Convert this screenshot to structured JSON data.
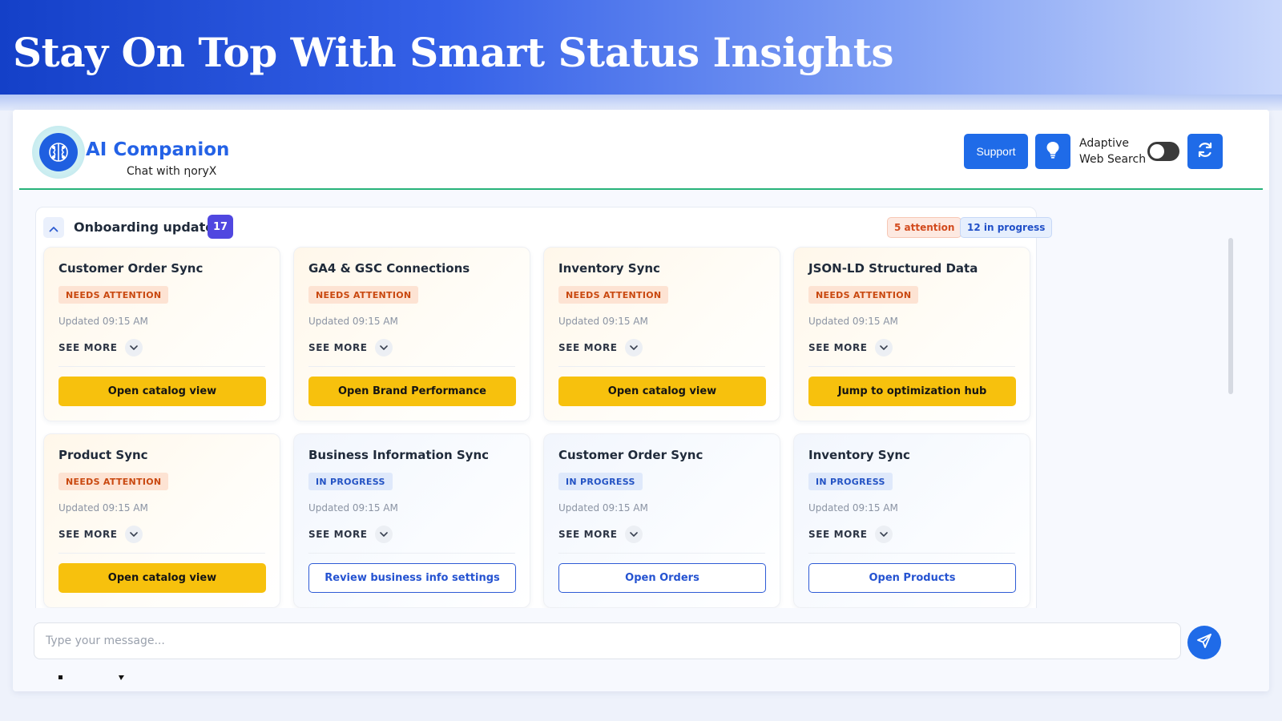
{
  "banner": {
    "title": "Stay On Top With Smart Status Insights"
  },
  "header": {
    "app_title": "AI Companion",
    "app_subtitle": "Chat with ηoryX",
    "support_label": "Support",
    "adaptive_label_line1": "Adaptive",
    "adaptive_label_line2": "Web Search",
    "adaptive_search_enabled": true,
    "icons": {
      "logo": "brain-icon",
      "bulb": "lightbulb-icon",
      "refresh": "refresh-icon"
    }
  },
  "onboarding": {
    "title": "Onboarding updates",
    "count": "17",
    "attention_pill": "5 attention",
    "progress_pill": "12 in progress",
    "see_more_label": "SEE MORE",
    "cards": [
      {
        "title": "Customer Order Sync",
        "status": "NEEDS ATTENTION",
        "updated": "Updated 09:15 AM",
        "action": "Open catalog view"
      },
      {
        "title": "GA4 & GSC Connections",
        "status": "NEEDS ATTENTION",
        "updated": "Updated 09:15 AM",
        "action": "Open Brand Performance"
      },
      {
        "title": "Inventory Sync",
        "status": "NEEDS ATTENTION",
        "updated": "Updated 09:15 AM",
        "action": "Open catalog view"
      },
      {
        "title": "JSON-LD Structured Data",
        "status": "NEEDS ATTENTION",
        "updated": "Updated 09:15 AM",
        "action": "Jump to optimization hub"
      },
      {
        "title": "Product Sync",
        "status": "NEEDS ATTENTION",
        "updated": "Updated 09:15 AM",
        "action": "Open catalog view"
      },
      {
        "title": "Business Information Sync",
        "status": "IN PROGRESS",
        "updated": "Updated 09:15 AM",
        "action": "Review business info settings"
      },
      {
        "title": "Customer Order Sync",
        "status": "IN PROGRESS",
        "updated": "Updated 09:15 AM",
        "action": "Open Orders"
      },
      {
        "title": "Inventory Sync",
        "status": "IN PROGRESS",
        "updated": "Updated 09:15 AM",
        "action": "Open Products"
      }
    ]
  },
  "composer": {
    "placeholder": "Type your message...",
    "send_icon": "send-icon"
  },
  "colors": {
    "brand_blue": "#1f6be8",
    "attention_bg": "#fde3d3",
    "attention_text": "#c9480f",
    "progress_bg": "#dfe9fb",
    "progress_text": "#2453c4",
    "primary_action": "#f7c10d",
    "count_badge": "#5047e0",
    "header_accent": "#27b37a"
  }
}
